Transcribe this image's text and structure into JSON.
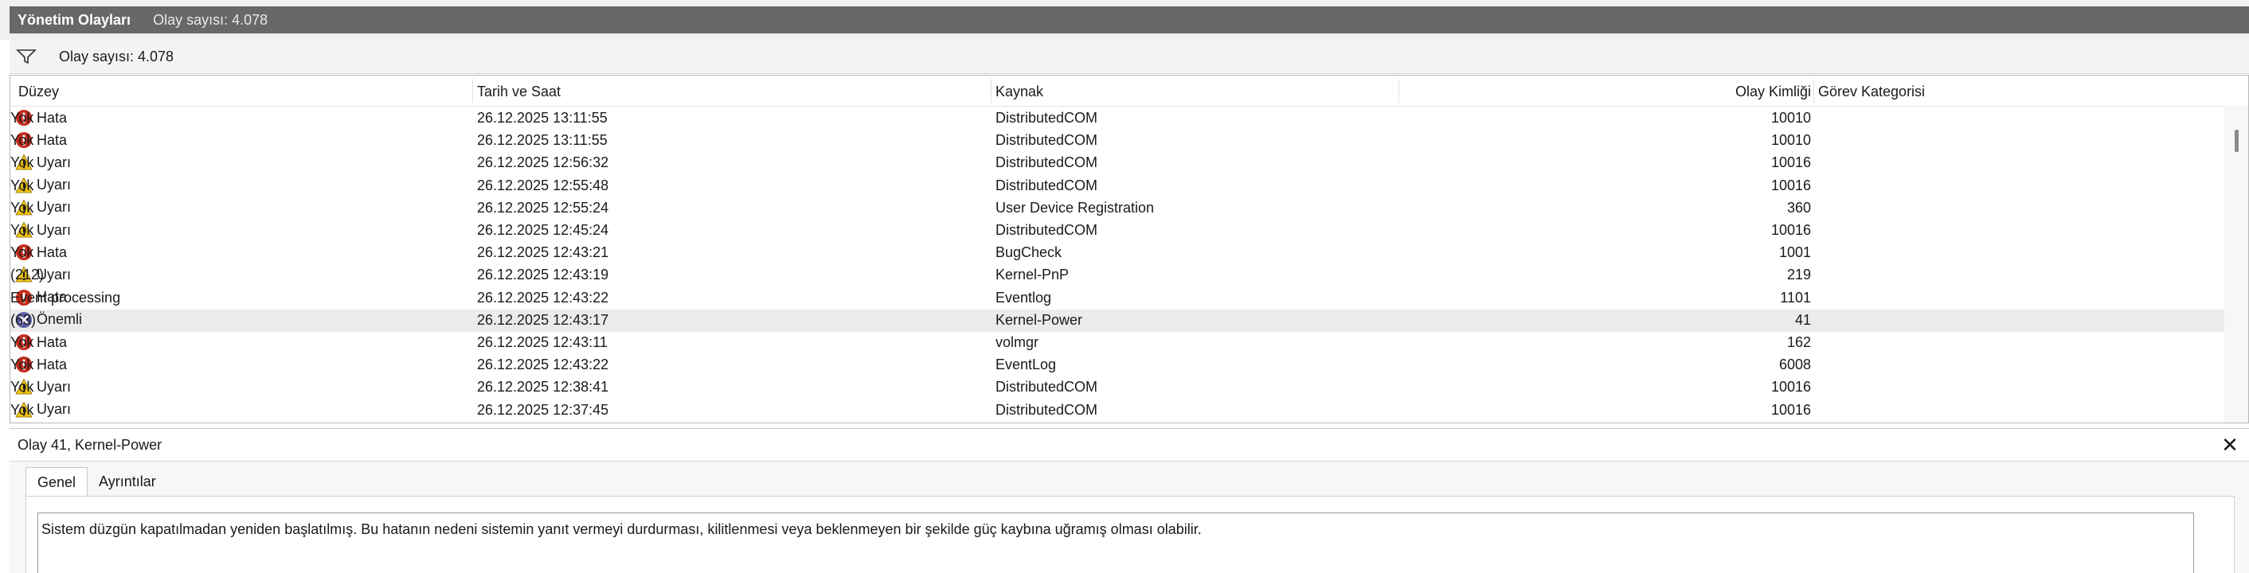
{
  "window": {
    "title": "Yönetim Olayları",
    "subtitle": "Olay sayısı: 4.078"
  },
  "filter": {
    "count_text": "Olay sayısı: 4.078"
  },
  "table": {
    "headers": [
      "Düzey",
      "Tarih ve Saat",
      "Kaynak",
      "Olay Kimliği",
      "Görev Kategorisi"
    ],
    "rows": [
      {
        "level": "Hata",
        "icon": "error-icon",
        "date": "26.12.2025 13:11:55",
        "source": "DistributedCOM",
        "id": "10010",
        "category": "Yok"
      },
      {
        "level": "Hata",
        "icon": "error-icon",
        "date": "26.12.2025 13:11:55",
        "source": "DistributedCOM",
        "id": "10010",
        "category": "Yok"
      },
      {
        "level": "Uyarı",
        "icon": "warning-icon",
        "date": "26.12.2025 12:56:32",
        "source": "DistributedCOM",
        "id": "10016",
        "category": "Yok"
      },
      {
        "level": "Uyarı",
        "icon": "warning-icon",
        "date": "26.12.2025 12:55:48",
        "source": "DistributedCOM",
        "id": "10016",
        "category": "Yok"
      },
      {
        "level": "Uyarı",
        "icon": "warning-icon",
        "date": "26.12.2025 12:55:24",
        "source": "User Device Registration",
        "id": "360",
        "category": "Yok"
      },
      {
        "level": "Uyarı",
        "icon": "warning-icon",
        "date": "26.12.2025 12:45:24",
        "source": "DistributedCOM",
        "id": "10016",
        "category": "Yok"
      },
      {
        "level": "Hata",
        "icon": "error-icon",
        "date": "26.12.2025 12:43:21",
        "source": "BugCheck",
        "id": "1001",
        "category": "Yok"
      },
      {
        "level": "Uyarı",
        "icon": "warning-icon",
        "date": "26.12.2025 12:43:19",
        "source": "Kernel-PnP",
        "id": "219",
        "category": "(212)"
      },
      {
        "level": "Hata",
        "icon": "error-icon",
        "date": "26.12.2025 12:43:22",
        "source": "Eventlog",
        "id": "1101",
        "category": "Event processing"
      },
      {
        "level": "Önemli",
        "icon": "critical-icon",
        "date": "26.12.2025 12:43:17",
        "source": "Kernel-Power",
        "id": "41",
        "category": "(63)",
        "selected": true
      },
      {
        "level": "Hata",
        "icon": "error-icon",
        "date": "26.12.2025 12:43:11",
        "source": "volmgr",
        "id": "162",
        "category": "Yok"
      },
      {
        "level": "Hata",
        "icon": "error-icon",
        "date": "26.12.2025 12:43:22",
        "source": "EventLog",
        "id": "6008",
        "category": "Yok"
      },
      {
        "level": "Uyarı",
        "icon": "warning-icon",
        "date": "26.12.2025 12:38:41",
        "source": "DistributedCOM",
        "id": "10016",
        "category": "Yok"
      },
      {
        "level": "Uyarı",
        "icon": "warning-icon",
        "date": "26.12.2025 12:37:45",
        "source": "DistributedCOM",
        "id": "10016",
        "category": "Yok"
      }
    ]
  },
  "detail": {
    "title": "Olay 41, Kernel-Power",
    "close_symbol": "✕",
    "tabs": [
      "Genel",
      "Ayrıntılar"
    ],
    "description": "Sistem düzgün kapatılmadan yeniden başlatılmış. Bu hatanın nedeni sistemin yanıt vermeyi durdurması, kilitlenmesi veya beklenmeyen bir şekilde güç kaybına uğramış olması olabilir."
  },
  "colors": {
    "title_bar": "#686868",
    "error": "#c42b1c",
    "warning": "#f2c511",
    "critical": "#5b5fa6",
    "selected_row": "#ebebeb"
  }
}
